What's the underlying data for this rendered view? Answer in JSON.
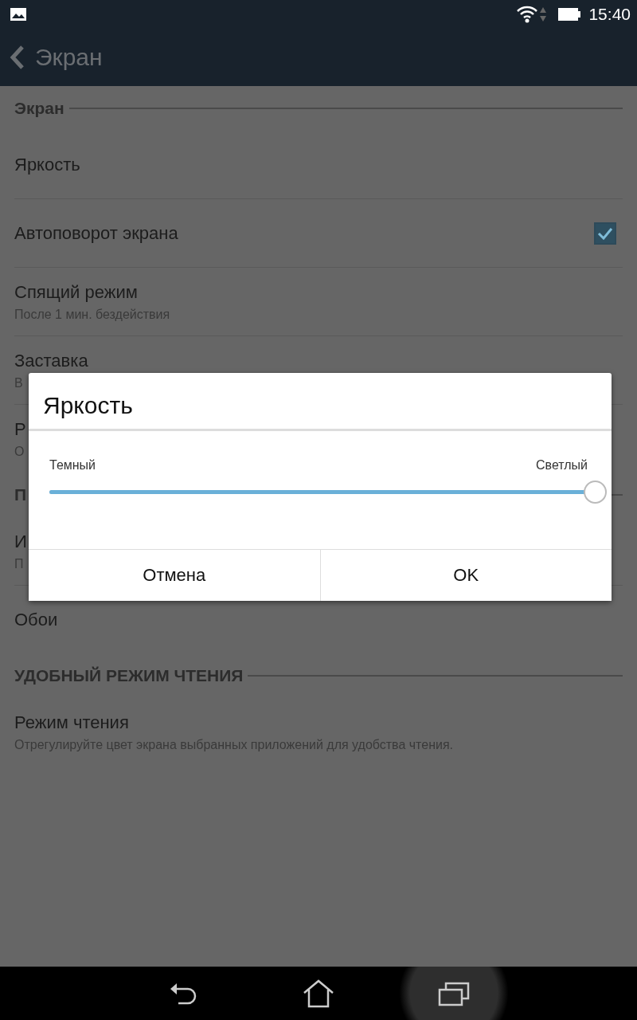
{
  "status_bar": {
    "time": "15:40"
  },
  "action_bar": {
    "title": "Экран"
  },
  "settings": [
    {
      "kind": "header",
      "title": "Экран"
    },
    {
      "kind": "item",
      "title": "Яркость"
    },
    {
      "kind": "checkbox",
      "title": "Автоповорот экрана",
      "checked": true
    },
    {
      "kind": "item",
      "title": "Спящий режим",
      "subtitle": "После 1 мин. бездействия"
    },
    {
      "kind": "item",
      "title": "Заставка",
      "subtitle": "В"
    },
    {
      "kind": "item",
      "title": "Р",
      "subtitle": "О"
    },
    {
      "kind": "header",
      "title": "П"
    },
    {
      "kind": "item",
      "title": "И",
      "subtitle": "П"
    },
    {
      "kind": "item",
      "title": "Обои"
    },
    {
      "kind": "header",
      "title": "УДОБНЫЙ РЕЖИМ ЧТЕНИЯ"
    },
    {
      "kind": "item",
      "title": "Режим чтения",
      "subtitle": "Отрегулируйте цвет экрана выбранных приложений для удобства чтения."
    }
  ],
  "dialog": {
    "title": "Яркость",
    "min_label": "Темный",
    "max_label": "Светлый",
    "level": 1.0,
    "buttons": [
      "Отмена",
      "OK"
    ]
  },
  "nav_bar": {
    "recents_pressed": true
  }
}
